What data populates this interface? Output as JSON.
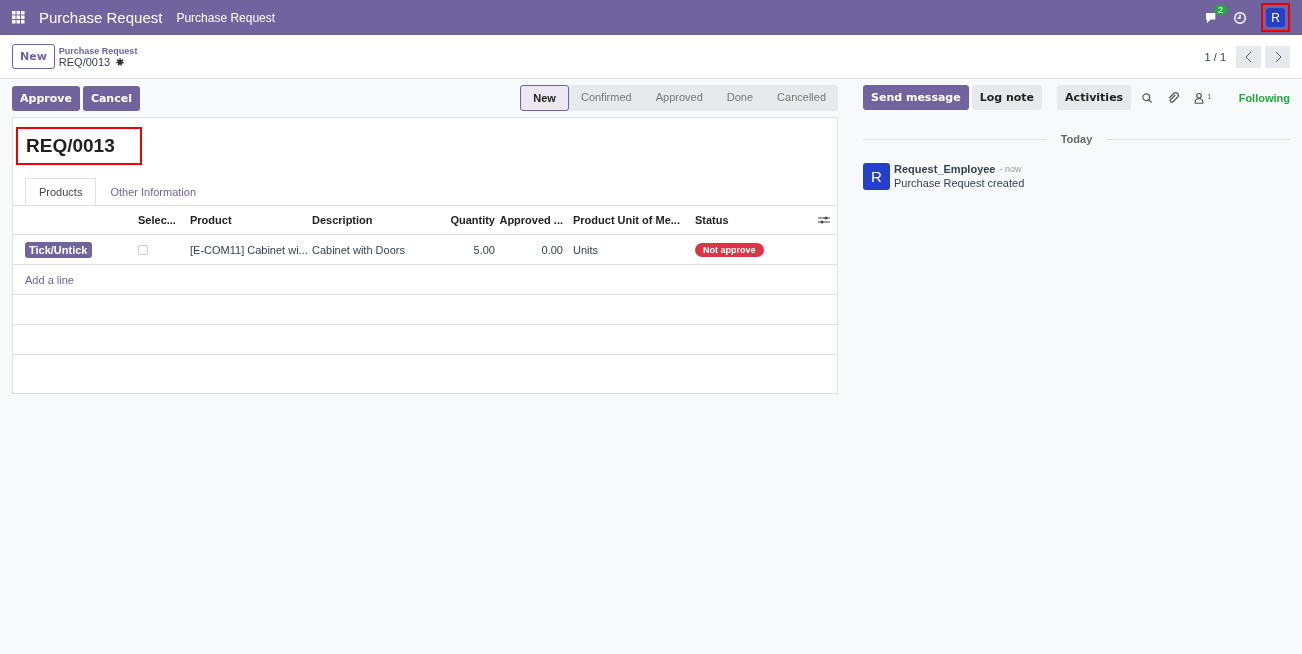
{
  "navbar": {
    "app_name": "Purchase Request",
    "menu": [
      "Purchase Request"
    ],
    "message_count": "2",
    "avatar": "R"
  },
  "control_panel": {
    "new_button": "New",
    "breadcrumb": "Purchase Request",
    "record": "REQ/0013",
    "pager": "1 / 1"
  },
  "actions": [
    "Approve",
    "Cancel"
  ],
  "stages": [
    {
      "label": "New",
      "selected": true
    },
    {
      "label": "Confirmed",
      "selected": false
    },
    {
      "label": "Approved",
      "selected": false
    },
    {
      "label": "Done",
      "selected": false
    },
    {
      "label": "Cancelled",
      "selected": false
    }
  ],
  "form": {
    "title": "REQ/0013",
    "tabs": [
      {
        "label": "Products",
        "selected": true
      },
      {
        "label": "Other Information",
        "selected": false
      }
    ],
    "columns": [
      "Selec...",
      "Product",
      "Description",
      "Quantity",
      "Approved ...",
      "Product Unit of Me...",
      "Status"
    ],
    "rows": [
      {
        "action": "Tick/Untick",
        "checked": false,
        "product": "[E-COM11] Cabinet wi...",
        "description": "Cabinet with Doors",
        "quantity": "5.00",
        "approved": "0.00",
        "uom": "Units",
        "status": "Not approve"
      }
    ],
    "add_line": "Add a line"
  },
  "chatter": {
    "buttons": [
      "Send message",
      "Log note",
      "Activities"
    ],
    "follower_count": "1",
    "following": "Following",
    "date_label": "Today",
    "messages": [
      {
        "avatar": "R",
        "author": "Request_Employee",
        "time": "- now",
        "body": "Purchase Request created"
      }
    ]
  }
}
